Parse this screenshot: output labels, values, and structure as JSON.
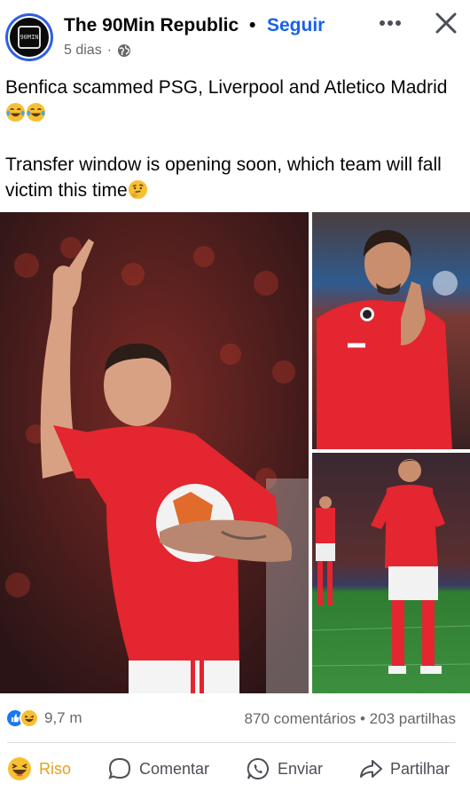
{
  "post": {
    "author": "The 90Min Republic",
    "separator": "•",
    "follow_label": "Seguir",
    "time": "5 dias",
    "meta_dot": "·",
    "privacy_icon": "globe-icon",
    "avatar_text": "90MIN",
    "text_line1": "Benfica scammed PSG, Liverpool and Atletico Madrid",
    "text_line2": "Transfer window is opening soon, which team will fall victim this time"
  },
  "stats": {
    "reaction_count": "9,7 m",
    "comments": "870 comentários",
    "dot": "•",
    "shares": "203 partilhas"
  },
  "actions": {
    "react_label": "Riso",
    "comment_label": "Comentar",
    "send_label": "Enviar",
    "share_label": "Partilhar"
  },
  "colors": {
    "accent": "#1a62e8",
    "like_blue": "#1877f2",
    "haha_yellow": "#f7c033",
    "jersey_red": "#e3262f",
    "pitch_green": "#2f7d32"
  }
}
